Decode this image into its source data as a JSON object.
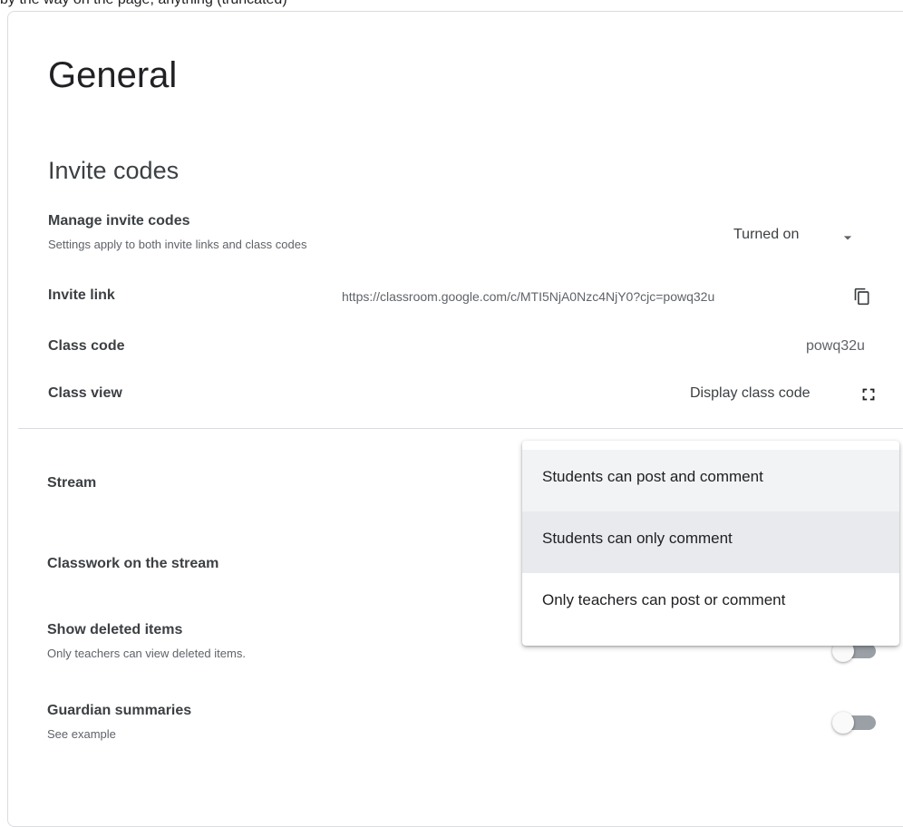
{
  "top_cut_text": "by the way on the page, anything (truncated)",
  "page": {
    "title": "General",
    "section_title": "Invite codes"
  },
  "invite_codes": {
    "manage_label": "Manage invite codes",
    "manage_sub": "Settings apply to both invite links and class codes",
    "manage_value": "Turned on",
    "invite_link_label": "Invite link",
    "invite_link_value": "https://classroom.google.com/c/MTI5NjA0Nzc4NjY0?cjc=powq32u",
    "class_code_label": "Class code",
    "class_code_value": "powq32u",
    "class_view_label": "Class view",
    "class_view_value": "Display class code"
  },
  "stream": {
    "stream_label": "Stream",
    "classwork_label": "Classwork on the stream",
    "deleted_label": "Show deleted items",
    "deleted_sub": "Only teachers can view deleted items.",
    "deleted_enabled": false,
    "guardian_label": "Guardian summaries",
    "guardian_sub": "See example",
    "guardian_enabled": false
  },
  "dropdown": {
    "options": [
      "Students can post and comment",
      "Students can only comment",
      "Only teachers can post or comment"
    ],
    "highlighted_index": 1
  },
  "icons": {
    "copy": "copy-icon",
    "fullscreen": "fullscreen-icon",
    "dropdown": "arrow-drop-down-icon"
  },
  "colors": {
    "text_primary": "#202124",
    "text_secondary": "#5f6368",
    "divider": "#dadce0",
    "menu_hover": "#f1f3f4",
    "menu_selected": "#e8eaed",
    "toggle_off_track": "#9aa0a6"
  }
}
